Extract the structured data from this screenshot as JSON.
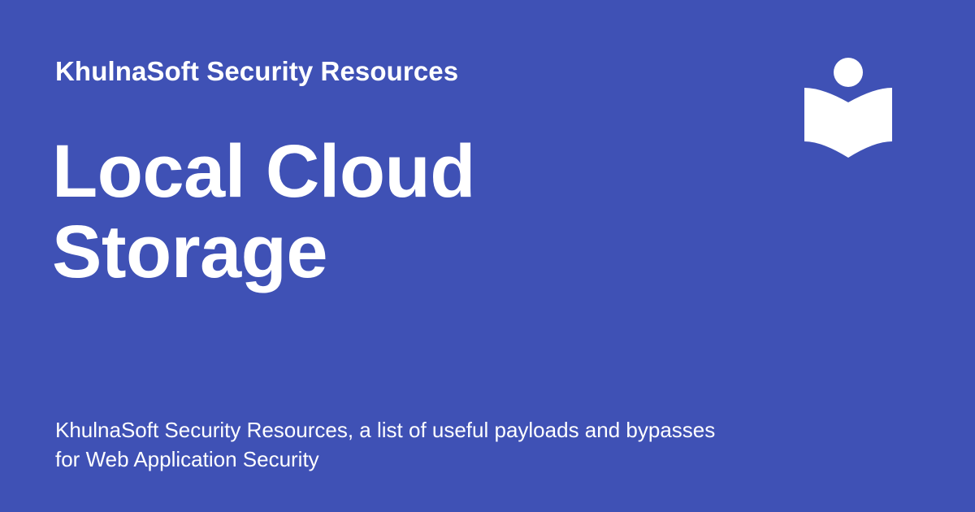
{
  "brand": {
    "background_color": "#3f51b5",
    "text_color": "#ffffff",
    "logo_icon": "reader-book-icon"
  },
  "site": {
    "name": "KhulnaSoft Security Resources"
  },
  "page": {
    "title_line_1": "Local Cloud",
    "title_line_2": "Storage",
    "description": "KhulnaSoft Security Resources, a list of useful payloads and bypasses for Web Application Security"
  }
}
